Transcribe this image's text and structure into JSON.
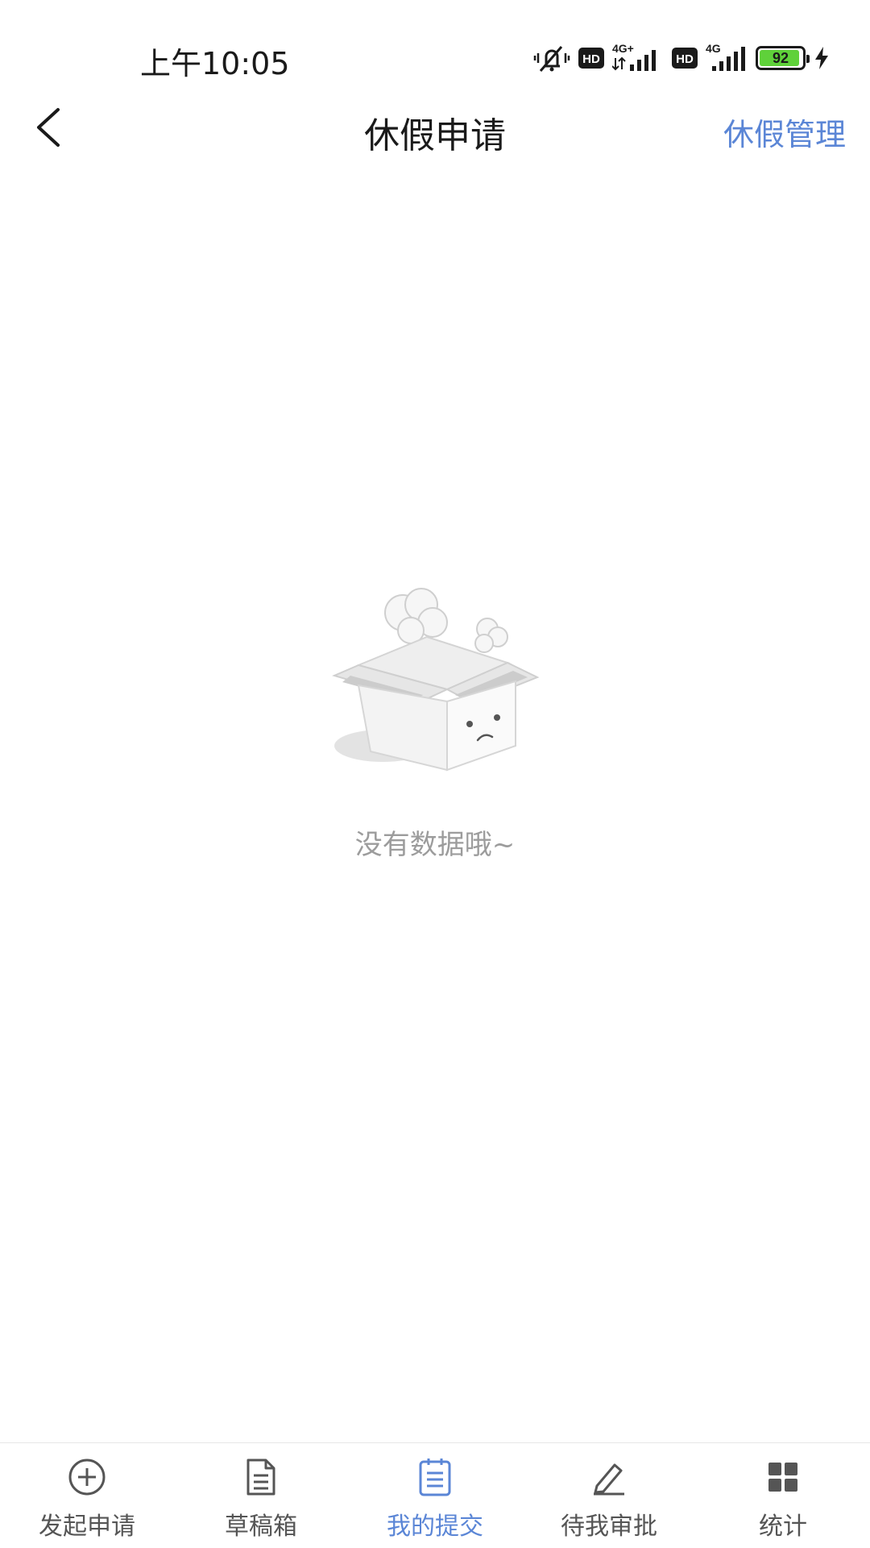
{
  "status_bar": {
    "time": "上午10:05",
    "battery_level": "92",
    "battery_color": "#5fd13a",
    "signal_1": "4G+",
    "signal_2": "4G",
    "hd_label": "HD"
  },
  "nav": {
    "back_icon": "chevron-left-icon",
    "title": "休假申请",
    "action_label": "休假管理",
    "action_color": "#5b86d6"
  },
  "empty_state": {
    "illustration": "empty-box-icon",
    "message": "没有数据哦~"
  },
  "tabs": [
    {
      "label": "发起申请",
      "icon": "plus-circle-icon",
      "active": false
    },
    {
      "label": "草稿箱",
      "icon": "document-icon",
      "active": false
    },
    {
      "label": "我的提交",
      "icon": "list-document-icon",
      "active": true
    },
    {
      "label": "待我审批",
      "icon": "pencil-icon",
      "active": false
    },
    {
      "label": "统计",
      "icon": "grid-icon",
      "active": false
    }
  ],
  "colors": {
    "accent": "#5b86d6",
    "tab_inactive": "#555555",
    "empty_text": "#9c9c9c"
  }
}
